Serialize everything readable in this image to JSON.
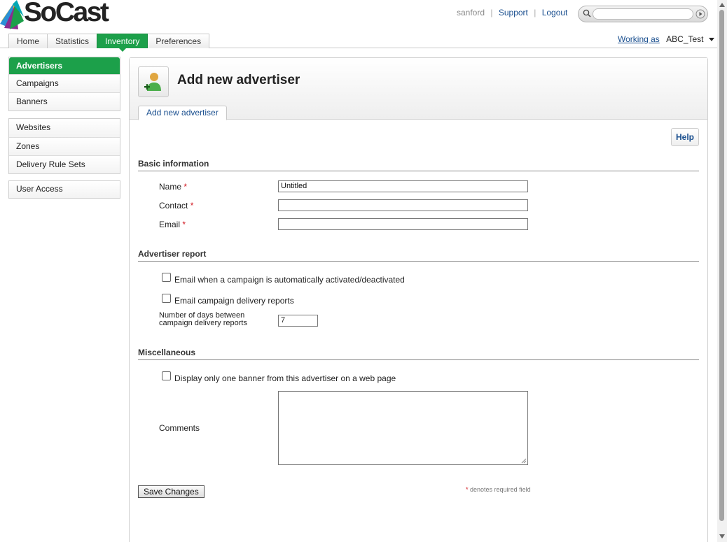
{
  "header": {
    "logo_text": "SoCast",
    "user": "sanford",
    "links": [
      "Support",
      "Logout"
    ],
    "search": {
      "placeholder": "",
      "value": ""
    },
    "tabs": [
      {
        "label": "Home",
        "active": false
      },
      {
        "label": "Statistics",
        "active": false
      },
      {
        "label": "Inventory",
        "active": true
      },
      {
        "label": "Preferences",
        "active": false
      }
    ],
    "working_as_label": "Working as",
    "account": "ABC_Test"
  },
  "sidebar": {
    "groups": [
      [
        "Advertisers",
        "Campaigns",
        "Banners"
      ],
      [
        "Websites",
        "Zones",
        "Delivery Rule Sets"
      ],
      [
        "User Access"
      ]
    ],
    "active_item": "Advertisers"
  },
  "page": {
    "title": "Add new advertiser",
    "subtab": "Add new advertiser",
    "help_label": "Help"
  },
  "form": {
    "basic_title": "Basic information",
    "name_label": "Name",
    "name_value": "Untitled",
    "contact_label": "Contact",
    "contact_value": "",
    "email_label": "Email",
    "email_value": "",
    "required_mark": "*",
    "report_title": "Advertiser report",
    "chk_activation_label": "Email when a campaign is automatically activated/deactivated",
    "chk_activation_checked": false,
    "chk_delivery_label": "Email campaign delivery reports",
    "chk_delivery_checked": false,
    "days_label_1": "Number of days between",
    "days_label_2": "campaign delivery reports",
    "days_value": "7",
    "misc_title": "Miscellaneous",
    "chk_onebanner_label": "Display only one banner from this advertiser on a web page",
    "chk_onebanner_checked": false,
    "comments_label": "Comments",
    "comments_value": "",
    "save_label": "Save Changes",
    "required_note": "denotes required field"
  },
  "colors": {
    "accent_green": "#1ca04a",
    "link_blue": "#1a4f8f",
    "required_red": "#d0141c"
  }
}
